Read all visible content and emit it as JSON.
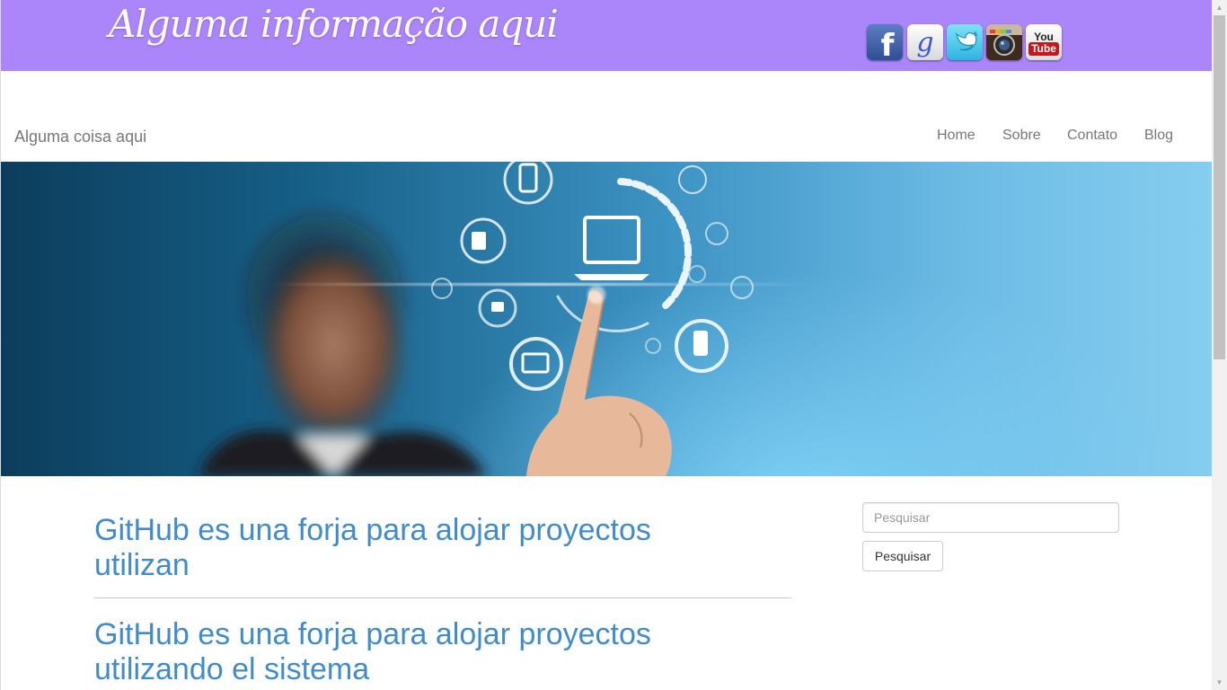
{
  "header": {
    "tagline": "Alguma informação aqui",
    "social": [
      {
        "name": "facebook",
        "glyph": "f"
      },
      {
        "name": "google",
        "glyph": "g"
      },
      {
        "name": "twitter",
        "glyph": "t"
      },
      {
        "name": "instagram",
        "glyph": ""
      },
      {
        "name": "youtube",
        "top": "You",
        "bottom": "Tube"
      }
    ]
  },
  "navbar": {
    "brand": "Alguma coisa aqui",
    "links": [
      "Home",
      "Sobre",
      "Contato",
      "Blog"
    ]
  },
  "hero": {
    "description_icon": "hand-touching-digital-interface-icons"
  },
  "posts": [
    {
      "title": "GitHub es una forja para alojar proyectos utilizan"
    },
    {
      "title": "GitHub es una forja para alojar proyectos utilizando el sistema"
    }
  ],
  "sidebar": {
    "search_placeholder": "Pesquisar",
    "search_button": "Pesquisar"
  },
  "colors": {
    "topbar": "#ab85fa",
    "link": "#428bca",
    "nav_text": "#777777"
  }
}
